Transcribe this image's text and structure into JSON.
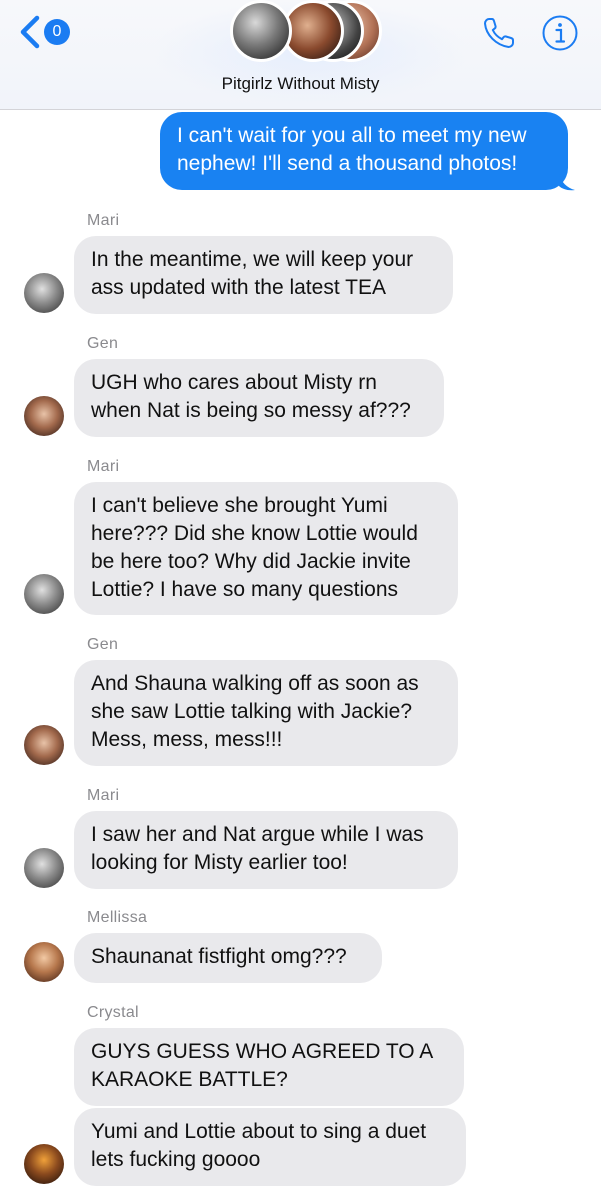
{
  "header": {
    "unread_count": "0",
    "group_name": "Pitgirlz Without Misty"
  },
  "messages": [
    {
      "type": "outgoing",
      "text": "I can't wait for you all to meet my new\nnephew! I'll send a thousand photos!"
    },
    {
      "type": "incoming",
      "sender": "Mari",
      "text": "In the meantime, we will keep your\nass updated with the latest TEA"
    },
    {
      "type": "incoming",
      "sender": "Gen",
      "text": "UGH who cares about Misty rn\nwhen Nat is being so messy af???"
    },
    {
      "type": "incoming",
      "sender": "Mari",
      "text": "I can't believe she brought Yumi\nhere??? Did she know Lottie would\nbe here too? Why did Jackie invite\nLottie? I have so many questions"
    },
    {
      "type": "incoming",
      "sender": "Gen",
      "text": "And Shauna walking off as soon as\nshe saw Lottie talking with Jackie?\nMess, mess, mess!!!"
    },
    {
      "type": "incoming",
      "sender": "Mari",
      "text": "I saw her and Nat argue while I was\nlooking for Misty earlier too!"
    },
    {
      "type": "incoming",
      "sender": "Mellissa",
      "text": "Shaunanat fistfight omg???"
    },
    {
      "type": "incoming",
      "sender": "Crystal",
      "text": "GUYS GUESS WHO AGREED TO A\nKARAOKE BATTLE?"
    },
    {
      "type": "incoming",
      "text": "Yumi and Lottie about to sing a duet\nlets fucking goooo"
    }
  ],
  "colors": {
    "accent": "#1982f2",
    "incoming_bubble": "#e9e9ec",
    "sender_label": "#8a8a8e"
  },
  "icons": [
    "back-chevron-icon",
    "phone-icon",
    "info-icon"
  ]
}
